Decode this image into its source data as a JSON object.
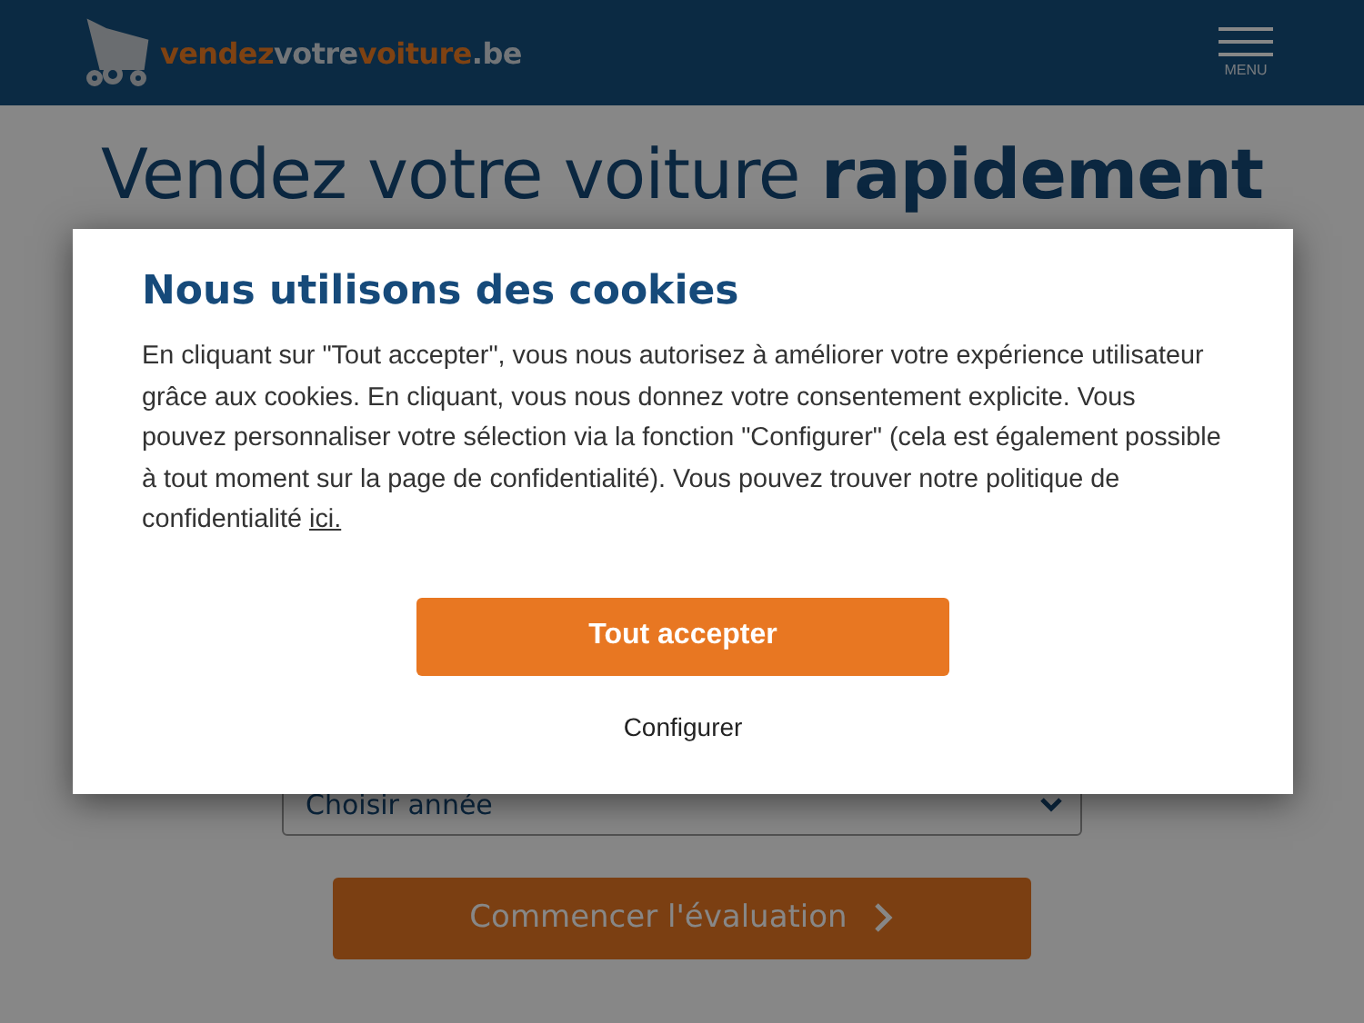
{
  "header": {
    "logo_parts": [
      {
        "text": "vendez",
        "kind": "accent"
      },
      {
        "text": "votre",
        "kind": "plain"
      },
      {
        "text": "voiture",
        "kind": "accent"
      },
      {
        "text": ".be",
        "kind": "plain"
      }
    ],
    "menu_label": "MENU"
  },
  "page": {
    "title": "Vendez votre voiture **rapidement**",
    "year_select": {
      "placeholder": "Choisir année"
    },
    "start_button": "Commencer l'évaluation"
  },
  "cookie_dialog": {
    "title": "Nous utilisons des cookies",
    "text": "En cliquant sur \"Tout accepter\", vous nous autorisez à améliorer votre expérience utilisateur grâce aux cookies. En cliquant, vous nous donnez votre consentement explicite. Vous pouvez personnaliser votre sélection via la fonction \"Configurer\" (cela est également possible à tout moment sur la page de confidentialité). Vous pouvez trouver notre politique de confidentialité",
    "link": "ici.",
    "accept_button": "Tout accepter",
    "configure_button": "Configurer"
  }
}
